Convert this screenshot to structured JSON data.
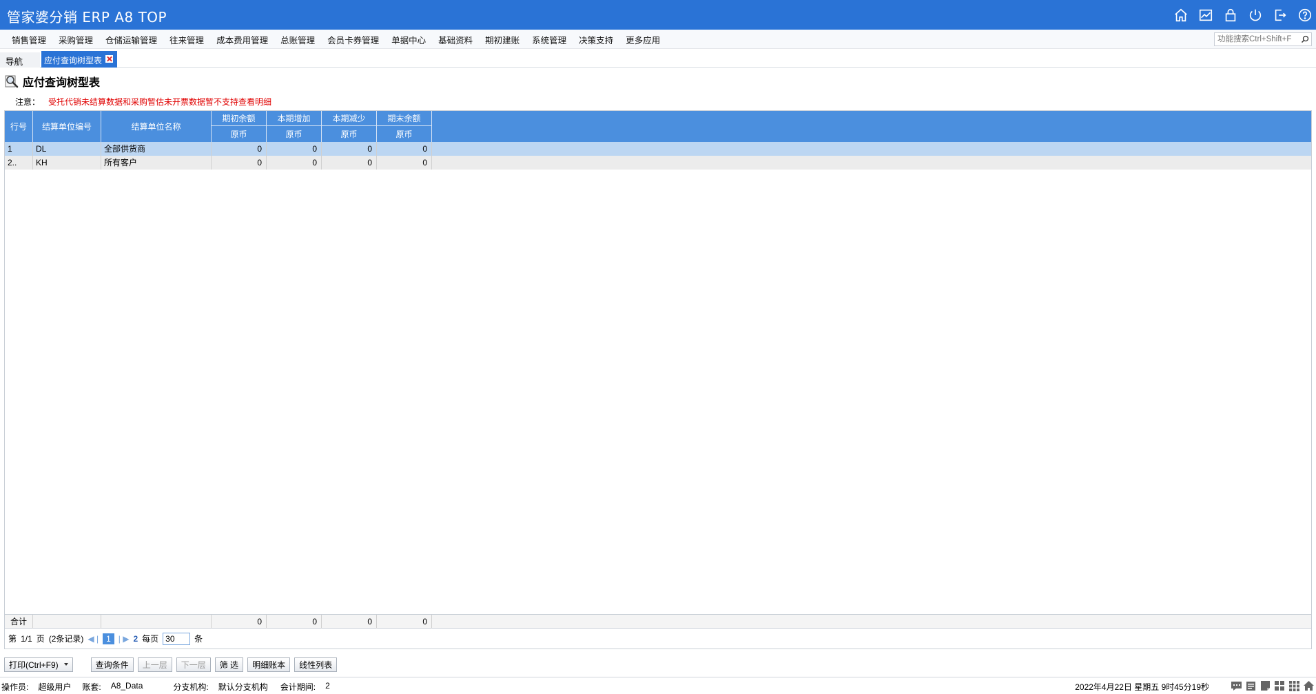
{
  "app": {
    "title": "管家婆分销 ERP A8 TOP"
  },
  "titlebar_icons": [
    "home-icon",
    "chart-icon",
    "lock-icon",
    "power-icon",
    "exit-icon",
    "help-icon"
  ],
  "menu": {
    "items": [
      "销售管理",
      "采购管理",
      "仓储运输管理",
      "往来管理",
      "成本费用管理",
      "总账管理",
      "会员卡券管理",
      "单据中心",
      "基础资料",
      "期初建账",
      "系统管理",
      "决策支持",
      "更多应用"
    ],
    "search_placeholder": "功能搜索Ctrl+Shift+F"
  },
  "tabs": {
    "nav_label": "导航",
    "active_label": "应付查询树型表"
  },
  "page": {
    "title": "应付查询树型表",
    "notice_label": "注意：",
    "notice_text": "受托代销未结算数据和采购暂估未开票数据暂不支持查看明细"
  },
  "grid": {
    "headers": {
      "row_no": "行号",
      "code": "结算单位编号",
      "name": "结算单位名称",
      "opening": "期初余额",
      "increase": "本期增加",
      "decrease": "本期减少",
      "closing": "期末余额",
      "currency": "原币"
    },
    "rows": [
      {
        "no": "1",
        "code": "DL",
        "name": "全部供货商",
        "opening": "0",
        "increase": "0",
        "decrease": "0",
        "closing": "0"
      },
      {
        "no": "2..",
        "code": "KH",
        "name": "所有客户",
        "opening": "0",
        "increase": "0",
        "decrease": "0",
        "closing": "0"
      }
    ],
    "total": {
      "label": "合计",
      "opening": "0",
      "increase": "0",
      "decrease": "0",
      "closing": "0"
    }
  },
  "pager": {
    "prefix": "第",
    "page_info": "1/1",
    "page_suffix": "页",
    "records": "(2条记录)",
    "current_page": "1",
    "page_link": "2",
    "per_page_label": "每页",
    "page_size": "30",
    "unit": "条"
  },
  "toolbar": {
    "print": "打印(Ctrl+F9)",
    "query": "查询条件",
    "up": "上一层",
    "down": "下一层",
    "filter": "筛 选",
    "detail": "明细账本",
    "linear": "线性列表"
  },
  "status": {
    "operator_label": "操作员:",
    "operator": "超级用户",
    "account_label": "账套:",
    "account": "A8_Data",
    "branch_label": "分支机构:",
    "branch": "默认分支机构",
    "period_label": "会计期间:",
    "period": "2",
    "datetime": "2022年4月22日  星期五  9时45分19秒"
  },
  "colors": {
    "title_bar": "#2a73d6",
    "grid_header": "#4b8fde",
    "selected_row": "#bcd6f2",
    "notice": "#e00000"
  }
}
